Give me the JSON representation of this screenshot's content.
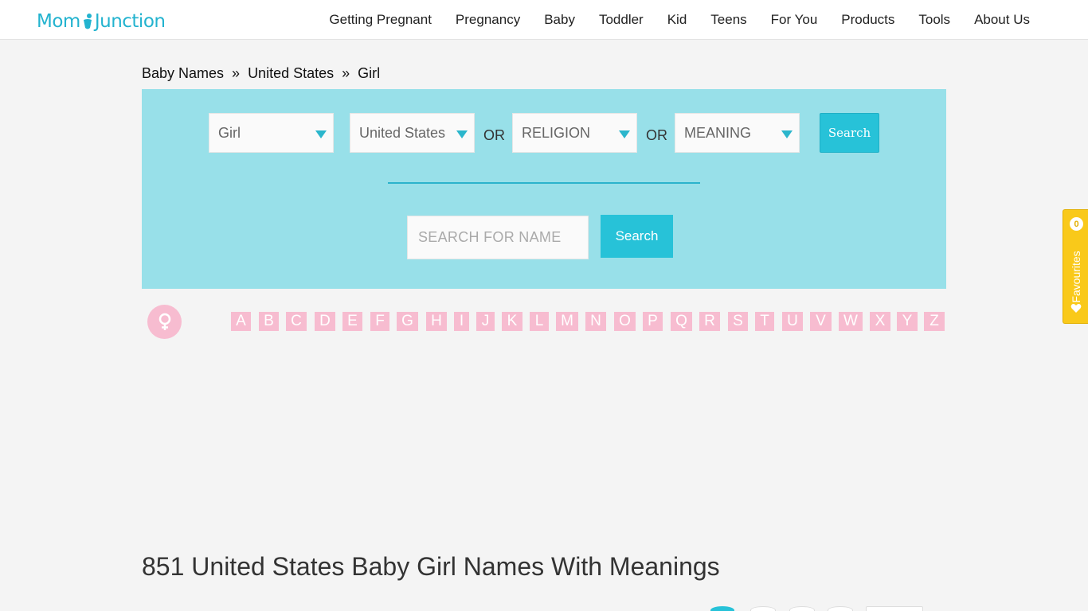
{
  "brand": {
    "logo_left": "Mom",
    "logo_right": "Junction"
  },
  "nav": [
    "Getting Pregnant",
    "Pregnancy",
    "Baby",
    "Toddler",
    "Kid",
    "Teens",
    "For You",
    "Products",
    "Tools",
    "About Us"
  ],
  "breadcrumb": {
    "items": [
      "Baby Names",
      "United States",
      "Girl"
    ],
    "separator": "»"
  },
  "filters": {
    "gender": "Girl",
    "origin": "United States",
    "or1": "OR",
    "religion": "RELIGION",
    "or2": "OR",
    "meaning": "MEANING",
    "search_label": "Search"
  },
  "name_search": {
    "placeholder": "SEARCH FOR NAME",
    "button_label": "Search"
  },
  "gender_icon": "female-icon",
  "alphabet": [
    "A",
    "B",
    "C",
    "D",
    "E",
    "F",
    "G",
    "H",
    "I",
    "J",
    "K",
    "L",
    "M",
    "N",
    "O",
    "P",
    "Q",
    "R",
    "S",
    "T",
    "U",
    "V",
    "W",
    "X",
    "Y",
    "Z"
  ],
  "favourites": {
    "count": "0",
    "label": "Favourites"
  },
  "page_title": "851 United States Baby Girl Names With Meanings",
  "colors": {
    "brand": "#23b3cf",
    "panel": "#98e0e9",
    "button": "#27c2d8",
    "alpha": "#f7bcd0",
    "favourites": "#f9c91a"
  }
}
